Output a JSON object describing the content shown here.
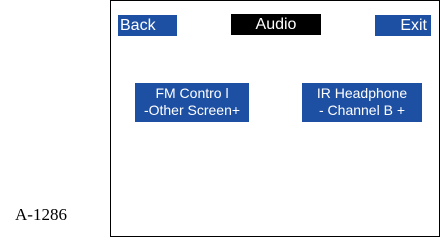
{
  "figure_label": "A-1286",
  "header": {
    "back_label": "Back",
    "title": "Audio",
    "exit_label": "Exit"
  },
  "tiles": [
    {
      "line1": "FM Contro l",
      "line2": "-Other Screen+"
    },
    {
      "line1": "IR Headphone",
      "line2": "- Channel B +"
    }
  ],
  "colors": {
    "button_blue": "#1d4fa3",
    "title_bg": "#000000",
    "text_on_button": "#ffffff"
  }
}
